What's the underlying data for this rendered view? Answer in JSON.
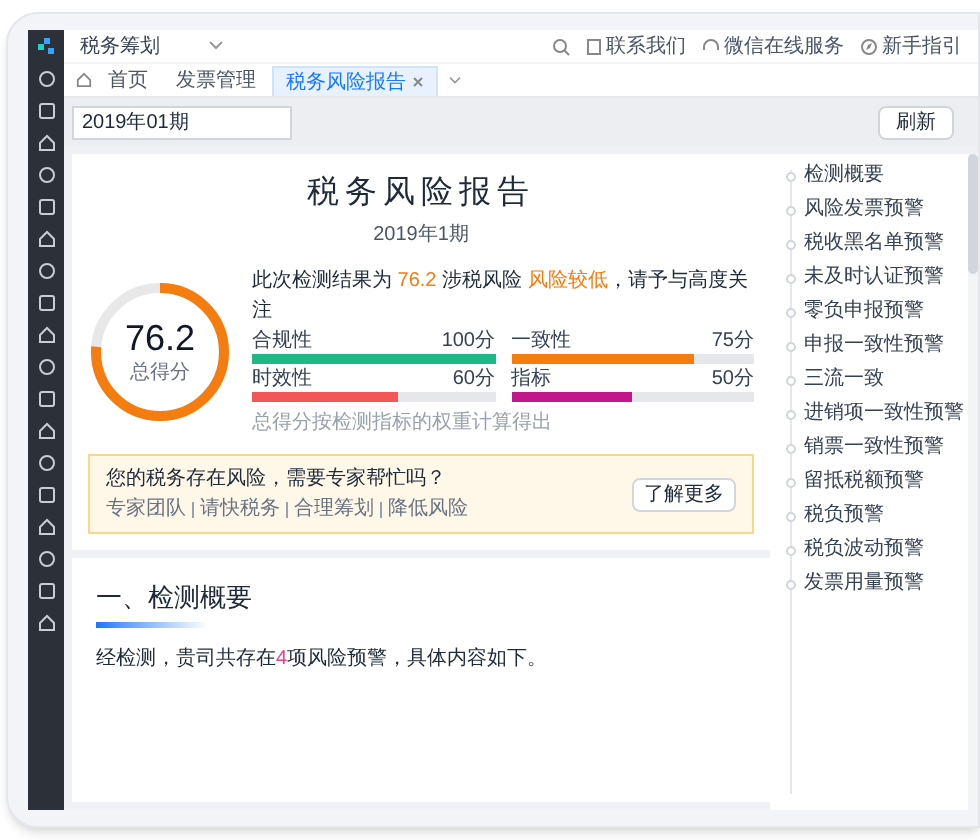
{
  "app_name": "税务筹划",
  "header_links": [
    {
      "label": "联系我们"
    },
    {
      "label": "微信在线服务"
    },
    {
      "label": "新手指引"
    }
  ],
  "tabs": [
    {
      "label": "首页",
      "selected": false,
      "closable": false
    },
    {
      "label": "发票管理",
      "selected": false,
      "closable": false
    },
    {
      "label": "税务风险报告",
      "selected": true,
      "closable": true
    }
  ],
  "period_field": {
    "value": "2019年01期"
  },
  "refresh_button": "刷新",
  "report": {
    "title": "税务风险报告",
    "period": "2019年1期",
    "score": {
      "value": "76.2",
      "label": "总得分",
      "level": 0.762
    },
    "summary": [
      {
        "text": "此次检测结果为 ",
        "kind": "plain"
      },
      {
        "text": "76.2",
        "kind": "highlight"
      },
      {
        "text": " 涉税风险 ",
        "kind": "plain"
      },
      {
        "text": "风险较低",
        "kind": "highlight"
      },
      {
        "text": "，请予与高度关注",
        "kind": "plain"
      }
    ],
    "metrics": [
      {
        "name": "合规性",
        "reading": "100分",
        "level": 1.0,
        "color": "#1fb785"
      },
      {
        "name": "一致性",
        "reading": "75分",
        "level": 0.75,
        "color": "#f57c0f"
      },
      {
        "name": "时效性",
        "reading": "60分",
        "level": 0.6,
        "color": "#f25757"
      },
      {
        "name": "指标",
        "reading": "50分",
        "level": 0.5,
        "color": "#c0188a"
      }
    ],
    "note": "总得分按检测指标的权重计算得出",
    "banner": {
      "question": "您的税务存在风险，需要专家帮忙吗？",
      "tags": [
        "专家团队",
        "请快税务",
        "合理筹划",
        "降低风险"
      ],
      "button": "了解更多"
    }
  },
  "section": {
    "heading": "一、检测概要",
    "text": [
      {
        "text": "经检测，贵司共存在",
        "kind": "plain"
      },
      {
        "text": "4",
        "kind": "highlight"
      },
      {
        "text": "项风险预警，具体内容如下。",
        "kind": "plain"
      }
    ]
  },
  "outline": [
    {
      "label": "检测概要"
    },
    {
      "label": "风险发票预警"
    },
    {
      "label": "税收黑名单预警"
    },
    {
      "label": "未及时认证预警"
    },
    {
      "label": "零负申报预警"
    },
    {
      "label": "申报一致性预警"
    },
    {
      "label": "三流一致"
    },
    {
      "label": "进销项一致性预警"
    },
    {
      "label": "销票一致性预警"
    },
    {
      "label": "留抵税额预警"
    },
    {
      "label": "税负预警"
    },
    {
      "label": "税负波动预警"
    },
    {
      "label": "发票用量预警"
    }
  ]
}
